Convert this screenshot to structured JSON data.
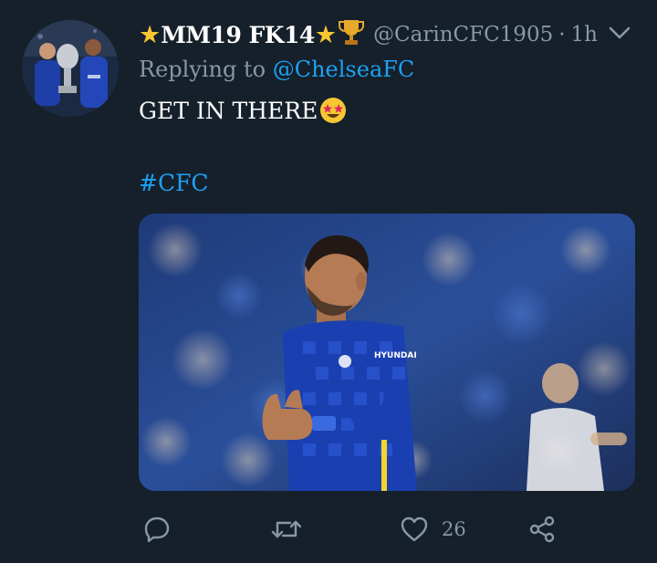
{
  "tweet": {
    "display_name": "MM19 FK14",
    "name_prefix_icon": "star-icon",
    "name_suffix_icons": [
      "star-icon",
      "trophy-icon"
    ],
    "handle": "@CarinCFC1905",
    "separator": "·",
    "time": "1h",
    "reply_prefix": "Replying to",
    "reply_to": "@ChelseaFC",
    "text": "GET IN THERE",
    "text_emoji": "star-struck-emoji",
    "hashtag": "#CFC",
    "media": {
      "description_icon": "footballer-photo",
      "shirt_sponsor": "HYUNDAI"
    },
    "actions": {
      "reply_icon": "reply-icon",
      "retweet_icon": "retweet-icon",
      "like_icon": "heart-icon",
      "like_count": "26",
      "share_icon": "share-icon"
    },
    "menu_icon": "chevron-down-icon"
  },
  "colors": {
    "background": "#15202b",
    "text_primary": "#ffffff",
    "text_secondary": "#8899a6",
    "accent": "#1da1f2",
    "star": "#f7c631"
  }
}
